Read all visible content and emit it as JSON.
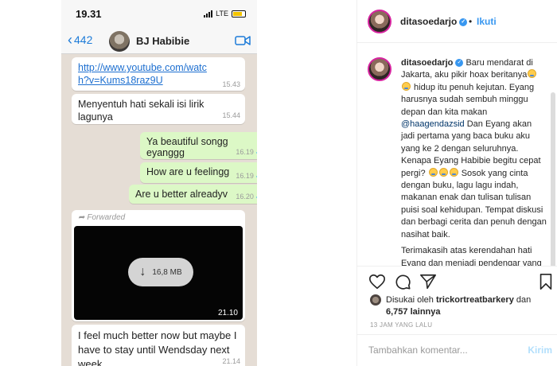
{
  "phone": {
    "status": {
      "time": "19.31",
      "network": "LTE"
    },
    "header": {
      "back_count": "442",
      "contact_name": "BJ Habibie"
    },
    "messages": [
      {
        "kind": "in",
        "link": "http://www.youtube.com/watch?v=Kums18raz9U",
        "time": "15.43"
      },
      {
        "kind": "in",
        "text": "Menyentuh hati sekali isi lirik lagunya",
        "time": "15.44"
      },
      {
        "kind": "out",
        "text": "Ya beautiful songg eyanggg",
        "time": "16.19"
      },
      {
        "kind": "out",
        "text": "How are u feelingg",
        "time": "16.19"
      },
      {
        "kind": "out",
        "text": "Are u better alreadyv",
        "time": "16.20"
      },
      {
        "kind": "in",
        "text": "I feel much better now but maybe I have to stay until Wendsday next week",
        "time": "21.14"
      }
    ],
    "forwarded": {
      "label": "Forwarded",
      "size": "16,8 MB",
      "time": "21.10"
    },
    "icons": {
      "back": "chevron-left-icon",
      "video": "video-call-icon",
      "call": "phone-icon"
    },
    "colors": {
      "outgoing": "#dcf8c6",
      "incoming": "#ffffff",
      "chat_bg": "#e5ddd5",
      "accent": "#1d7bd8"
    }
  },
  "instagram": {
    "header": {
      "username": "ditasoedarjo",
      "separator": "•",
      "follow": "Ikuti"
    },
    "caption": {
      "username": "ditasoedarjo",
      "paragraphs": [
        [
          {
            "t": "Baru mendarat di Jakarta, aku pikir hoax beritanya"
          },
          {
            "e": "crying-face-icon"
          },
          {
            "e": "crying-face-icon"
          },
          {
            "t": " hidup itu penuh kejutan. Eyang harusnya sudah sembuh minggu depan dan kita makan "
          },
          {
            "m": "@haagendazsid"
          },
          {
            "t": " Dan Eyang akan jadi pertama yang baca buku aku yang ke 2 dengan seluruhnya. Kenapa Eyang Habibie begitu cepat pergi? "
          },
          {
            "e": "crying-face-icon"
          },
          {
            "e": "crying-face-icon"
          },
          {
            "e": "crying-face-icon"
          },
          {
            "t": " Sosok yang cinta dengan buku, lagu lagu indah, makanan enak dan tulisan tulisan puisi soal kehidupan. Tempat diskusi dan berbagi cerita dan penuh dengan nasihat baik."
          }
        ],
        [
          {
            "t": "Terimakasih atas kerendahan hati Eyang dan menjadi pendengar yang baik dan tempat tukar pikiran.orang yang hebat itu bukan yang hanya"
          }
        ]
      ]
    },
    "likes": {
      "prefix": "Disukai oleh",
      "liker": "trickortreatbarkery",
      "joiner": "dan",
      "count": "6,757 lainnya"
    },
    "time_ago": "13 JAM YANG LALU",
    "comment": {
      "placeholder": "Tambahkan komentar...",
      "post": "Kirim"
    },
    "icons": [
      "heart-icon",
      "comment-icon",
      "share-icon",
      "bookmark-icon"
    ],
    "colors": {
      "link": "#3897f0",
      "text": "#262626",
      "muted": "#999999"
    }
  }
}
